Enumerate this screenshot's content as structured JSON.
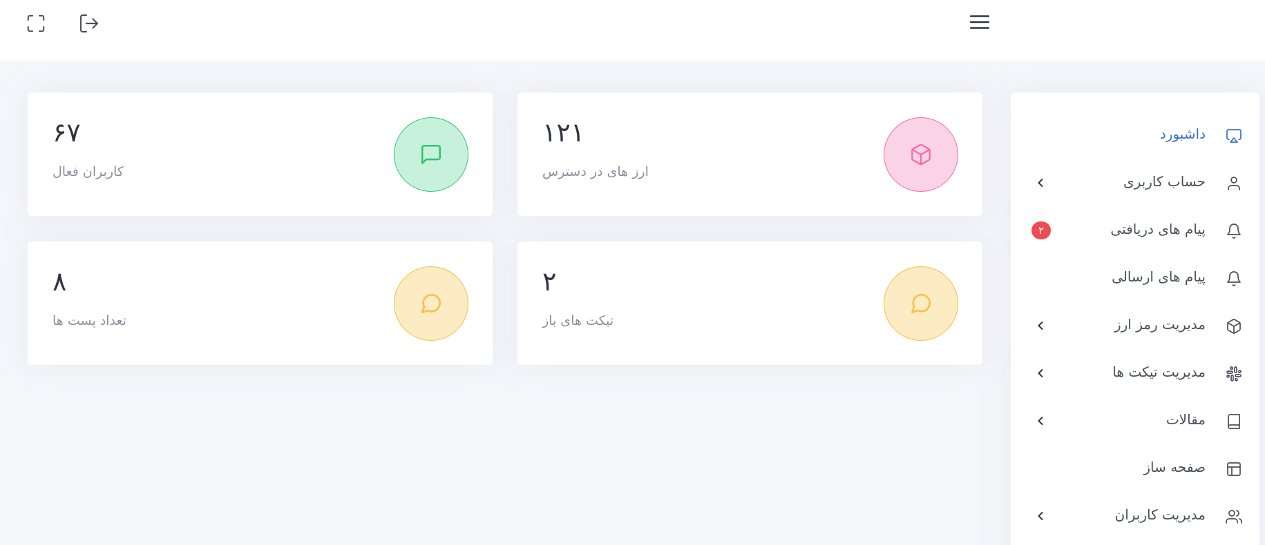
{
  "header": {
    "menu_icon": "hamburger-menu-icon",
    "logout_icon": "logout-icon",
    "fullscreen_icon": "fullscreen-icon"
  },
  "stats": [
    {
      "value": "۱۲۱",
      "label": "ارز های در دسترس",
      "icon": "cube-icon",
      "bg": "#fbd3e6",
      "accent": "#f26ea5"
    },
    {
      "value": "۶۷",
      "label": "کاربران فعال",
      "icon": "message-square-icon",
      "bg": "#c8f1dc",
      "accent": "#2dc86f"
    },
    {
      "value": "۲",
      "label": "تیکت های باز",
      "icon": "message-circle-icon",
      "bg": "#fdebc3",
      "accent": "#f5c042"
    },
    {
      "value": "۸",
      "label": "تعداد پست ها",
      "icon": "message-circle-icon",
      "bg": "#fdebc3",
      "accent": "#f5c042"
    }
  ],
  "sidebar": {
    "items": [
      {
        "label": "داشبورد",
        "icon": "airplay-icon",
        "active": true
      },
      {
        "label": "حساب کاربری",
        "icon": "user-icon",
        "chevron": true
      },
      {
        "label": "پیام های دریافتی",
        "icon": "bell-icon",
        "badge": "۲"
      },
      {
        "label": "پیام های ارسالی",
        "icon": "bell-icon"
      },
      {
        "label": "مدیریت رمز ارز",
        "icon": "cube-icon",
        "chevron": true
      },
      {
        "label": "مدیریت تیکت ها",
        "icon": "slack-icon",
        "chevron": true
      },
      {
        "label": "مقالات",
        "icon": "book-icon",
        "chevron": true
      },
      {
        "label": "صفحه ساز",
        "icon": "layout-icon"
      },
      {
        "label": "مدیریت کاربران",
        "icon": "users-icon",
        "chevron": true
      }
    ]
  },
  "colors": {
    "accent": "#3b6fd4",
    "badge": "#ef4b55"
  }
}
